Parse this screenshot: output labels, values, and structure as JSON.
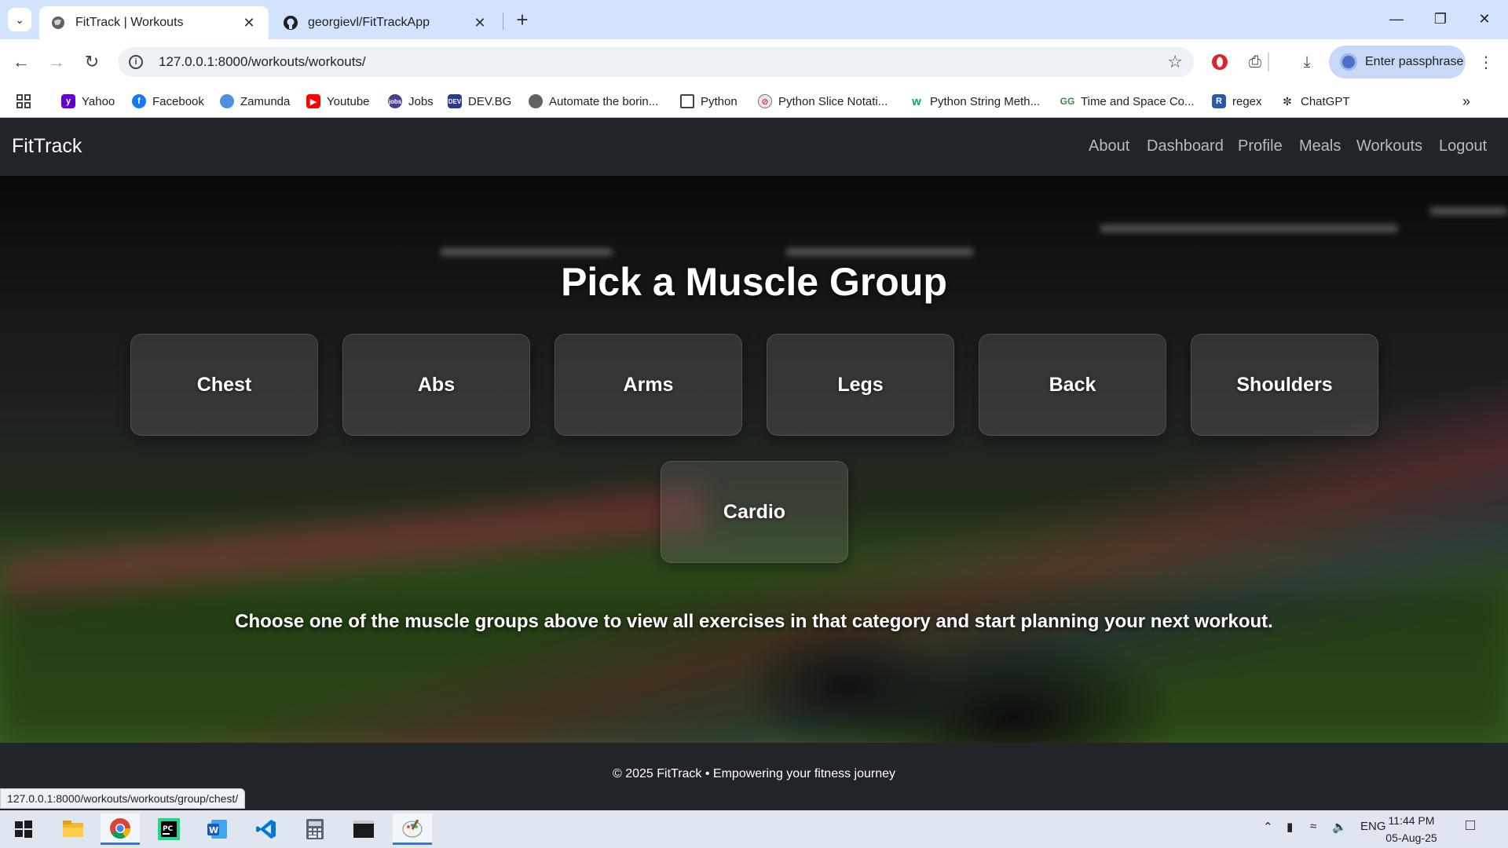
{
  "browser": {
    "tabs": [
      {
        "title": "FitTrack | Workouts",
        "active": true,
        "icon": "globe-icon"
      },
      {
        "title": "georgievl/FitTrackApp",
        "active": false,
        "icon": "github-icon"
      }
    ],
    "url": "127.0.0.1:8000/workouts/workouts/",
    "profile_button": "Enter passphrase",
    "bookmarks": [
      {
        "label": "Yahoo",
        "icon": "yahoo-icon"
      },
      {
        "label": "Facebook",
        "icon": "facebook-icon"
      },
      {
        "label": "Zamunda",
        "icon": "zamunda-icon"
      },
      {
        "label": "Youtube",
        "icon": "youtube-icon"
      },
      {
        "label": "Jobs",
        "icon": "jobs-icon"
      },
      {
        "label": "DEV.BG",
        "icon": "devbg-icon"
      },
      {
        "label": "Automate the borin...",
        "icon": "globe-icon"
      },
      {
        "label": "Python",
        "icon": "folder-icon"
      },
      {
        "label": "Python Slice Notati...",
        "icon": "python-icon"
      },
      {
        "label": "Python String Meth...",
        "icon": "w3schools-icon"
      },
      {
        "label": "Time and Space Co...",
        "icon": "geeksforgeeks-icon"
      },
      {
        "label": "regex",
        "icon": "regex-icon"
      },
      {
        "label": "ChatGPT",
        "icon": "chatgpt-icon"
      }
    ],
    "status_url": "127.0.0.1:8000/workouts/workouts/group/chest/"
  },
  "site": {
    "brand": "FitTrack",
    "nav": [
      "About",
      "Dashboard",
      "Profile",
      "Meals",
      "Workouts",
      "Logout"
    ],
    "title": "Pick a Muscle Group",
    "groups": [
      "Chest",
      "Abs",
      "Arms",
      "Legs",
      "Back",
      "Shoulders",
      "Cardio"
    ],
    "subtitle": "Choose one of the muscle groups above to view all exercises in that category and start planning your next workout.",
    "footer": "© 2025 FitTrack • Empowering your fitness journey"
  },
  "taskbar": {
    "apps": [
      "start-icon",
      "file-explorer-icon",
      "chrome-icon",
      "pycharm-icon",
      "word-icon",
      "vscode-icon",
      "calculator-icon",
      "terminal-icon",
      "paint-icon"
    ],
    "language": "ENG",
    "time": "11:44 PM",
    "date": "05-Aug-25"
  },
  "colors": {
    "navbar": "#212529",
    "tabstrip": "#d3e3fd",
    "accent": "#3a78d4"
  }
}
